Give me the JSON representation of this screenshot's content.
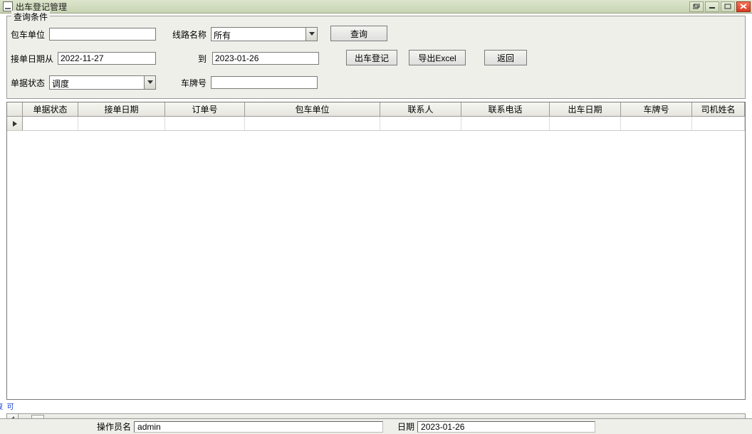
{
  "window": {
    "title": "出车登记管理"
  },
  "query": {
    "legend": "查询条件",
    "unit_label": "包车单位",
    "unit_value": "",
    "route_label": "线路名称",
    "route_value": "所有",
    "search_btn": "查询",
    "date_from_label": "接单日期从",
    "date_from_value": "2022-11-27",
    "date_to_label": "到",
    "date_to_value": "2023-01-26",
    "register_btn": "出车登记",
    "export_btn": "导出Excel",
    "back_btn": "返回",
    "status_label": "单据状态",
    "status_value": "调度",
    "plate_label": "车牌号",
    "plate_value": ""
  },
  "grid": {
    "columns": [
      "单据状态",
      "接单日期",
      "订单号",
      "包车单位",
      "联系人",
      "联系电话",
      "出车日期",
      "车牌号",
      "司机姓名"
    ],
    "rows": []
  },
  "statusbar": {
    "operator_label": "操作员名",
    "operator_value": "admin",
    "date_label": "日期",
    "date_value": "2023-01-26"
  }
}
